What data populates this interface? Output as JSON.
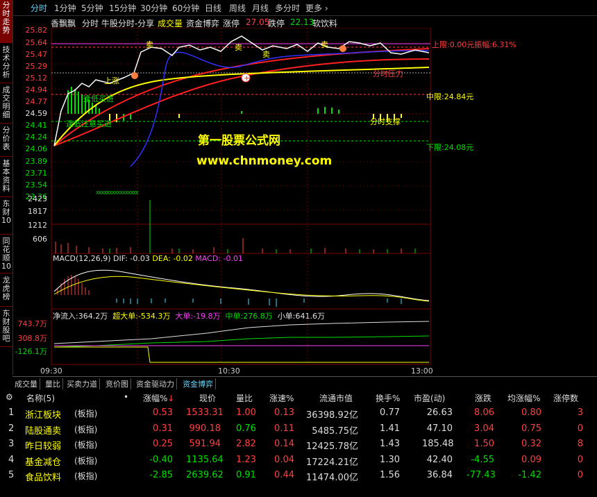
{
  "left_nav": [
    "分时走势",
    "技术分析",
    "成交明细",
    "分价表",
    "基本资料",
    "东财10",
    "同花顺10",
    "龙虎榜",
    "东财股吧"
  ],
  "period_tabs": [
    "分时",
    "1分钟",
    "5分钟",
    "15分钟",
    "30分钟",
    "60分钟",
    "日线",
    "周线",
    "月线",
    "多分时",
    "更多"
  ],
  "active_period": "分时",
  "info_row": {
    "stock_name": "香飘飘",
    "indicator": "分时 牛股分时-分享",
    "vol_label": "成交量",
    "fund_label": "资金博弈",
    "limit_up_label": "涨停",
    "limit_up_value": "27.05",
    "limit_down_label": "跌停",
    "limit_down_value": "22.13",
    "sector": "软饮料"
  },
  "price_axis": [
    "25.82",
    "25.64",
    "25.47",
    "25.29",
    "25.12",
    "24.94",
    "24.77",
    "24.59",
    "24.41",
    "24.24",
    "24.06",
    "23.89",
    "23.71",
    "23.54",
    "23.36"
  ],
  "volume_axis": [
    "2423",
    "1817",
    "1212",
    "606"
  ],
  "fund_axis": [
    "743.7万",
    "308.8万",
    "-126.1万"
  ],
  "time_axis": [
    "09:30",
    "10:30",
    "13:00"
  ],
  "annotations": {
    "upper_limit": "上限:0.00元振幅:6.31%",
    "middle": "中限:24.84元",
    "lower": "下限:24.08元",
    "support": "分时支撑",
    "pressure": "分时压力",
    "sell": "卖",
    "buy_hint": "逢低买进",
    "buy_hint2": "逢低注意买进",
    "rise": "上涨",
    "xxx": "XXXXXXXXXXXXXXXX"
  },
  "watermark": {
    "line1": "第一股票公式网",
    "line2": "www.chnmoney.com"
  },
  "macd": {
    "label": "MACD(12,26,9)",
    "dif": "DIF: -0.03",
    "dea": "DEA: -0.02",
    "macd": "MACD: -0.01"
  },
  "fund_flow": {
    "net": "净流入:364.2万",
    "super": "超大单:-534.3万",
    "big": "大单:-19.8万",
    "mid": "中单:276.8万",
    "small": "小单:641.6万"
  },
  "bottom_tabs": [
    "成交量",
    "量比",
    "买卖力道",
    "竞价图",
    "资金驱动力",
    "资金博弈"
  ],
  "active_bottom_tab": "资金博弈",
  "table": {
    "headers": [
      "名称(5)",
      "•",
      "涨幅%",
      "现价",
      "量比",
      "涨速%",
      "流通市值",
      "换手%",
      "市盈(动)",
      "涨跌",
      "均涨幅%",
      "涨停数"
    ],
    "rows": [
      {
        "idx": "1",
        "name": "浙江板块",
        "tag": "(板指)",
        "chg": "0.53",
        "price": "1533.31",
        "vr": "1.00",
        "speed": "0.13",
        "cap": "36398.92亿",
        "turn": "0.77",
        "pe": "26.63",
        "diff": "8.06",
        "avg": "0.80",
        "lim": "3",
        "up": true
      },
      {
        "idx": "2",
        "name": "陆股通卖",
        "tag": "(板指)",
        "chg": "0.31",
        "price": "990.18",
        "vr": "0.76",
        "speed": "0.11",
        "cap": "5485.75亿",
        "turn": "1.41",
        "pe": "47.10",
        "diff": "3.04",
        "avg": "0.75",
        "lim": "0",
        "up": true
      },
      {
        "idx": "3",
        "name": "昨日较弱",
        "tag": "(板指)",
        "chg": "0.25",
        "price": "591.94",
        "vr": "2.82",
        "speed": "0.14",
        "cap": "12425.78亿",
        "turn": "1.43",
        "pe": "185.48",
        "diff": "1.50",
        "avg": "0.32",
        "lim": "8",
        "up": true
      },
      {
        "idx": "4",
        "name": "基金减仓",
        "tag": "(板指)",
        "chg": "-0.40",
        "price": "1135.64",
        "vr": "1.23",
        "speed": "0.04",
        "cap": "17224.21亿",
        "turn": "1.30",
        "pe": "42.40",
        "diff": "-4.55",
        "avg": "0.09",
        "lim": "0",
        "up": false
      },
      {
        "idx": "5",
        "name": "食品饮料",
        "tag": "(板指)",
        "chg": "-2.85",
        "price": "2639.62",
        "vr": "0.91",
        "speed": "0.44",
        "cap": "11474.00亿",
        "turn": "1.56",
        "pe": "36.84",
        "diff": "-77.43",
        "avg": "-1.42",
        "lim": "0",
        "up": false
      }
    ]
  }
}
